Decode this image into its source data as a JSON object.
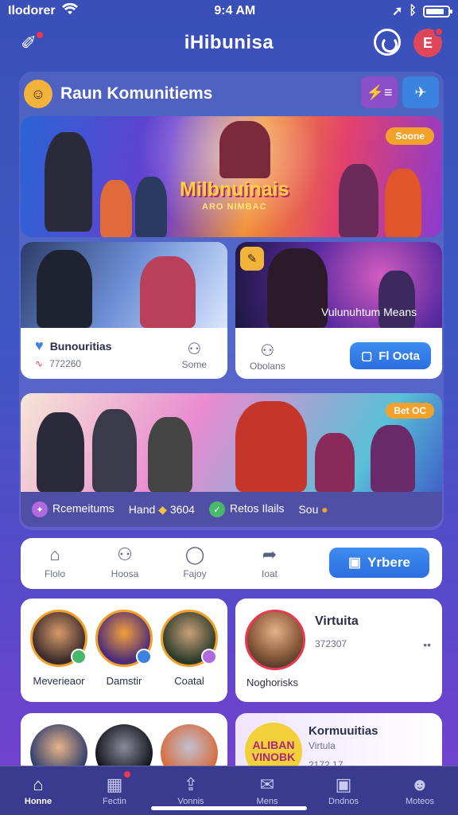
{
  "status": {
    "carrier": "Ilodorer",
    "time": "9:4 AM",
    "wifi_icon": "wifi-icon",
    "battery_icon": "battery-icon"
  },
  "appbar": {
    "title": "iHibunisa",
    "avatar_initial": "E"
  },
  "section": {
    "title": "Raun Komunitiems",
    "action_1_label": "⚡≡",
    "action_2_label": "✈"
  },
  "banner": {
    "headline": "Milbnuinais",
    "subline": "ARO NIMBAC",
    "tag": "Soone"
  },
  "card_left": {
    "title": "Bunouritias",
    "count": "772260",
    "right_label": "Some"
  },
  "card_right": {
    "overlay": "Vulunuhtum Means",
    "left_label": "Obolans",
    "cta_label": "Fl Oota"
  },
  "wide": {
    "left_label": "Rcemeitums",
    "mid_label": "Hand",
    "mid_value": "3604",
    "right_label": "Retos Ilails",
    "more_label": "Sou",
    "corner_tag": "Bet OC"
  },
  "nav": {
    "items": [
      {
        "label": "Flolo",
        "icon": "home-outline-icon"
      },
      {
        "label": "Hoosa",
        "icon": "group-icon"
      },
      {
        "label": "Fajoy",
        "icon": "circle-icon"
      },
      {
        "label": "Ioat",
        "icon": "share-icon"
      }
    ],
    "cta_label": "Yrbere"
  },
  "groups": {
    "items": [
      {
        "label": "Meverieaor"
      },
      {
        "label": "Damstir"
      },
      {
        "label": "Coatal"
      }
    ]
  },
  "featured": {
    "title": "Virtuita",
    "count": "372307",
    "more": "••",
    "name": "Noghorisks"
  },
  "bottom_card": {
    "seal_text": "ALIBAN VINOBK",
    "title": "Kormuuitias",
    "subtitle": "Virtula",
    "number": "2172 17"
  },
  "tabs": [
    {
      "label": "Honne",
      "icon": "home-icon"
    },
    {
      "label": "Fectin",
      "icon": "calendar-icon"
    },
    {
      "label": "Vonnis",
      "icon": "upload-icon"
    },
    {
      "label": "Mens",
      "icon": "chat-icon"
    },
    {
      "label": "Dndnos",
      "icon": "box-icon"
    },
    {
      "label": "Moteos",
      "icon": "person-icon"
    }
  ],
  "colors": {
    "accent_blue": "#3f8cf0",
    "accent_orange": "#f2a12a",
    "alert_red": "#e8394f",
    "purple": "#8a4fc8"
  }
}
